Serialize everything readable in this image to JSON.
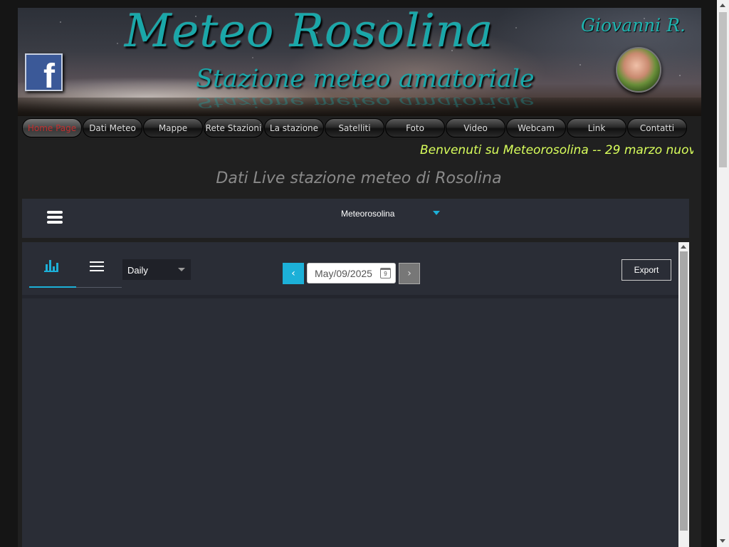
{
  "header": {
    "title": "Meteo Rosolina",
    "subtitle": "Stazione meteo amatoriale",
    "author": "Giovanni R.",
    "facebook_glyph": "f"
  },
  "nav": {
    "items": [
      {
        "label": "Home Page",
        "active": true
      },
      {
        "label": "Dati Meteo"
      },
      {
        "label": "Mappe"
      },
      {
        "label": "Rete Stazioni"
      },
      {
        "label": "La stazione"
      },
      {
        "label": "Satelliti"
      },
      {
        "label": "Foto"
      },
      {
        "label": "Video"
      },
      {
        "label": "Webcam"
      },
      {
        "label": "Link"
      },
      {
        "label": "Contatti"
      }
    ]
  },
  "marquee": {
    "text": "Benvenuti su Meteorosolina -- 29 marzo nuov"
  },
  "page": {
    "heading": "Dati Live stazione meteo di Rosolina"
  },
  "widget": {
    "station": "Meteorosolina",
    "period": "Daily",
    "date": "May/09/2025",
    "calendar_day": "9",
    "prev_glyph": "‹",
    "next_glyph": "›",
    "export_label": "Export"
  },
  "colors": {
    "accent": "#1cb0d8",
    "title_teal": "#1aa7a9",
    "marquee": "#d9ff5c",
    "active_nav": "#c03030",
    "widget_bg": "#2a2d36"
  }
}
